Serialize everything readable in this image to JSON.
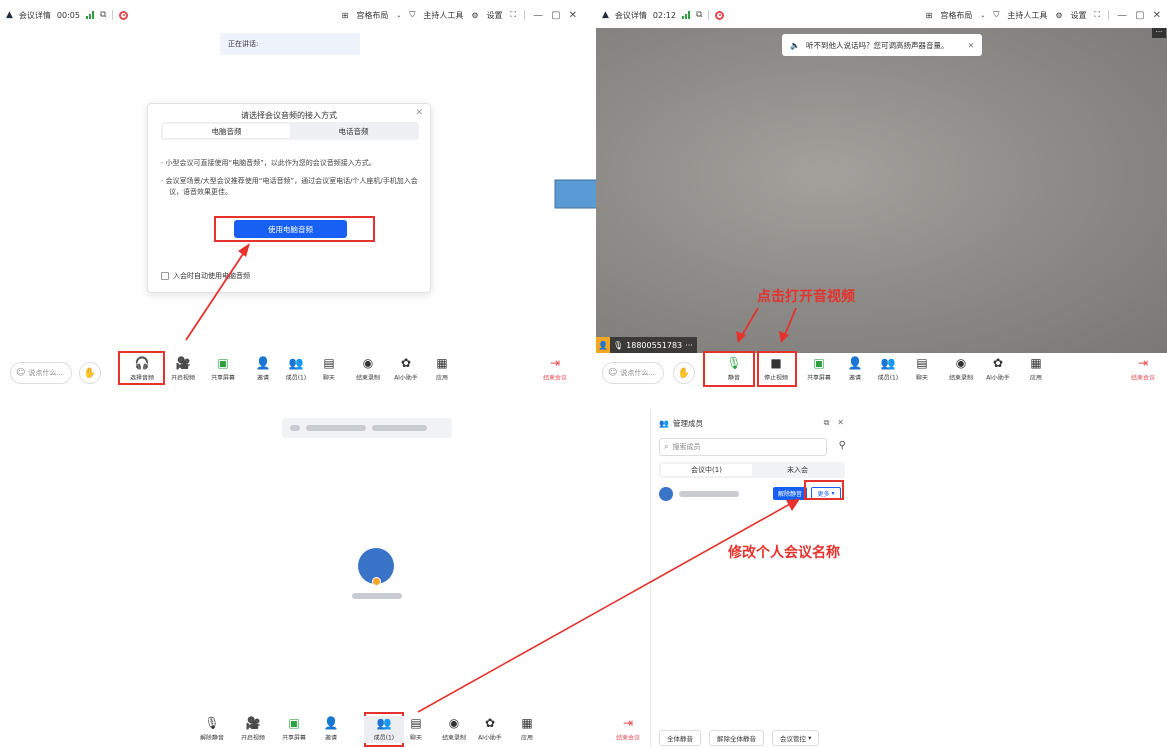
{
  "top_left": {
    "titlebar": {
      "meeting_details": "会议详情",
      "elapsed": "00:05",
      "layout": "宫格布局",
      "host_tools": "主持人工具",
      "settings": "设置"
    },
    "speaking_label": "正在讲话:",
    "dialog": {
      "title": "请选择会议音频的接入方式",
      "tab_computer": "电脑音频",
      "tab_phone": "电话音频",
      "bullet1": "小型会议可直接使用“电脑音频”，以此作为您的会议音频接入方式。",
      "bullet2": "会议室场景/大型会议推荐使用“电话音频”，通过会议室电话/个人座机/手机加入会议，语音效果更佳。",
      "use_button": "使用电脑音频",
      "auto_checkbox": "入会时自动使用电脑音频"
    },
    "toolbar": {
      "say_placeholder": "说点什么...",
      "select_audio": "选择音频",
      "start_video": "开启视频",
      "share_screen": "共享屏幕",
      "invite": "邀请",
      "members": "成员(1)",
      "chat": "聊天",
      "end_record": "结束录制",
      "ai_assistant": "AI小助手",
      "apps": "应用",
      "end_meeting": "结束会议"
    }
  },
  "top_right": {
    "titlebar": {
      "meeting_details": "会议详情",
      "elapsed": "02:12",
      "layout": "宫格布局",
      "host_tools": "主持人工具",
      "settings": "设置"
    },
    "toast": "听不到他人说话吗？您可调高扬声器音量。",
    "name_tag": "18800551783",
    "annotation": "点击打开音视频",
    "toolbar": {
      "say_placeholder": "说点什么...",
      "mute": "静音",
      "stop_video": "停止视频",
      "share_screen": "共享屏幕",
      "invite": "邀请",
      "members": "成员(1)",
      "chat": "聊天",
      "end_record": "结束录制",
      "ai_assistant": "AI小助手",
      "apps": "应用",
      "end_meeting": "结束会议"
    }
  },
  "bottom": {
    "side_panel": {
      "title": "管理成员",
      "search_placeholder": "搜索成员",
      "tab_in_meeting": "会议中(1)",
      "tab_not_joined": "未入会",
      "unmute": "解除静音",
      "more": "更多",
      "mute_all": "全体静音",
      "unmute_all": "解除全体静音",
      "meeting_control": "会议管控"
    },
    "annotation": "修改个人会议名称",
    "toolbar": {
      "unmute": "解除静音",
      "start_video": "开启视频",
      "share_screen": "共享屏幕",
      "invite": "邀请",
      "members": "成员(1)",
      "chat": "聊天",
      "end_record": "结束录制",
      "ai_assistant": "AI小助手",
      "apps": "应用",
      "end_meeting": "结束会议"
    }
  },
  "colors": {
    "primary": "#1760f3",
    "annotation_red": "#e5322d",
    "end_red": "#e5484d",
    "arrow_blue": "#5b9bd5"
  }
}
